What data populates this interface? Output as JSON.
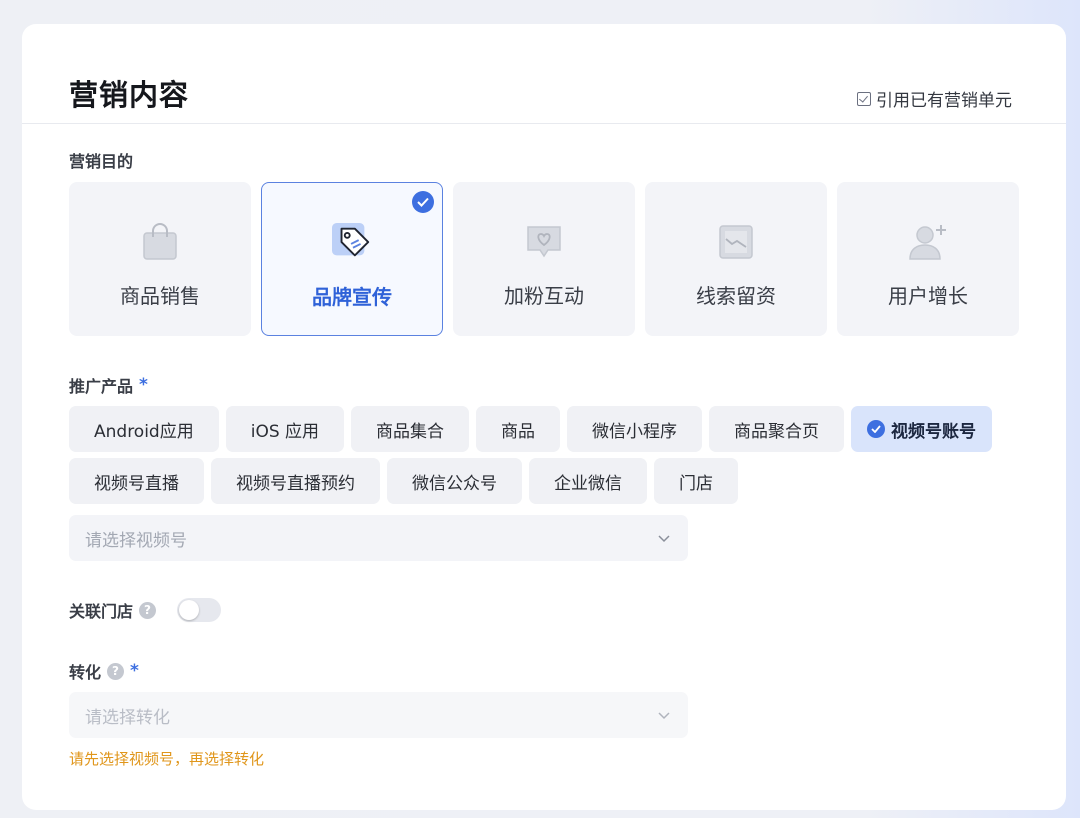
{
  "header": {
    "title": "营销内容",
    "ref_link": "引用已有营销单元"
  },
  "goal_section": {
    "label": "营销目的",
    "items": [
      {
        "label": "商品销售",
        "icon": "shopping-bag-icon",
        "selected": false
      },
      {
        "label": "品牌宣传",
        "icon": "brand-tag-icon",
        "selected": true
      },
      {
        "label": "加粉互动",
        "icon": "heart-chat-icon",
        "selected": false
      },
      {
        "label": "线索留资",
        "icon": "image-form-icon",
        "selected": false
      },
      {
        "label": "用户增长",
        "icon": "add-user-icon",
        "selected": false
      }
    ]
  },
  "product_section": {
    "label": "推广产品",
    "required_mark": "*",
    "chips": [
      {
        "label": "Android应用",
        "selected": false
      },
      {
        "label": "iOS 应用",
        "selected": false
      },
      {
        "label": "商品集合",
        "selected": false
      },
      {
        "label": "商品",
        "selected": false
      },
      {
        "label": "微信小程序",
        "selected": false
      },
      {
        "label": "商品聚合页",
        "selected": false
      },
      {
        "label": "视频号账号",
        "selected": true
      },
      {
        "label": "视频号直播",
        "selected": false
      },
      {
        "label": "视频号直播预约",
        "selected": false
      },
      {
        "label": "微信公众号",
        "selected": false
      },
      {
        "label": "企业微信",
        "selected": false
      },
      {
        "label": "门店",
        "selected": false
      }
    ],
    "select_placeholder": "请选择视频号"
  },
  "store_section": {
    "label": "关联门店",
    "help": "?",
    "toggle_on": false
  },
  "conversion_section": {
    "label": "转化",
    "help": "?",
    "required_mark": "*",
    "select_placeholder": "请选择转化",
    "warning": "请先选择视频号，再选择转化"
  },
  "colors": {
    "accent": "#3d6fe0",
    "selected_text": "#2f62d8",
    "warning": "#e0961b",
    "card_bg": "#f3f4f8"
  }
}
